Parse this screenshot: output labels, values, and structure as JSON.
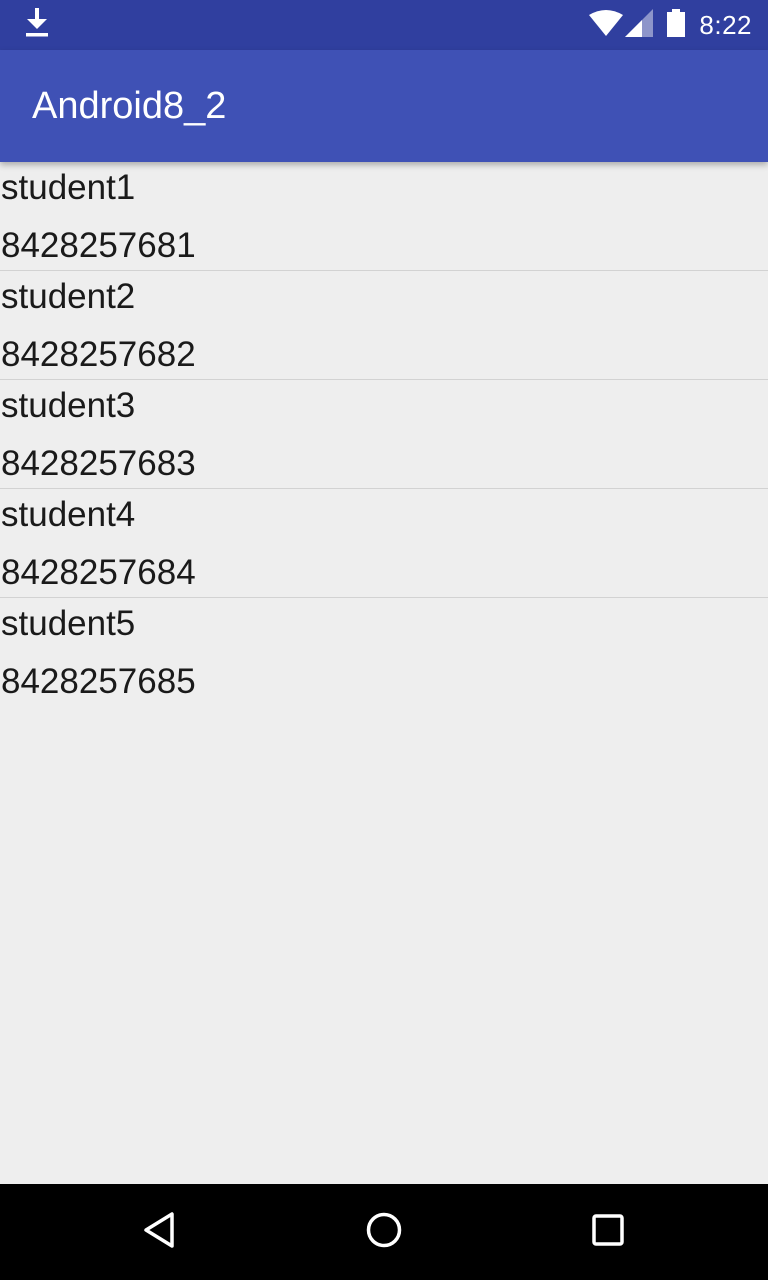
{
  "status_bar": {
    "time": "8:22",
    "icons": [
      "download-icon",
      "wifi-icon",
      "cell-signal-icon",
      "battery-icon"
    ]
  },
  "app_bar": {
    "title": "Android8_2"
  },
  "students": [
    {
      "name": "student1",
      "phone": "8428257681"
    },
    {
      "name": "student2",
      "phone": "8428257682"
    },
    {
      "name": "student3",
      "phone": "8428257683"
    },
    {
      "name": "student4",
      "phone": "8428257684"
    },
    {
      "name": "student5",
      "phone": "8428257685"
    }
  ],
  "nav_bar": {
    "buttons": [
      "back-icon",
      "home-icon",
      "recents-icon"
    ]
  },
  "colors": {
    "status_bar": "#303f9f",
    "app_bar": "#3f51b5",
    "background": "#eeeeee",
    "nav_bar": "#000000"
  }
}
